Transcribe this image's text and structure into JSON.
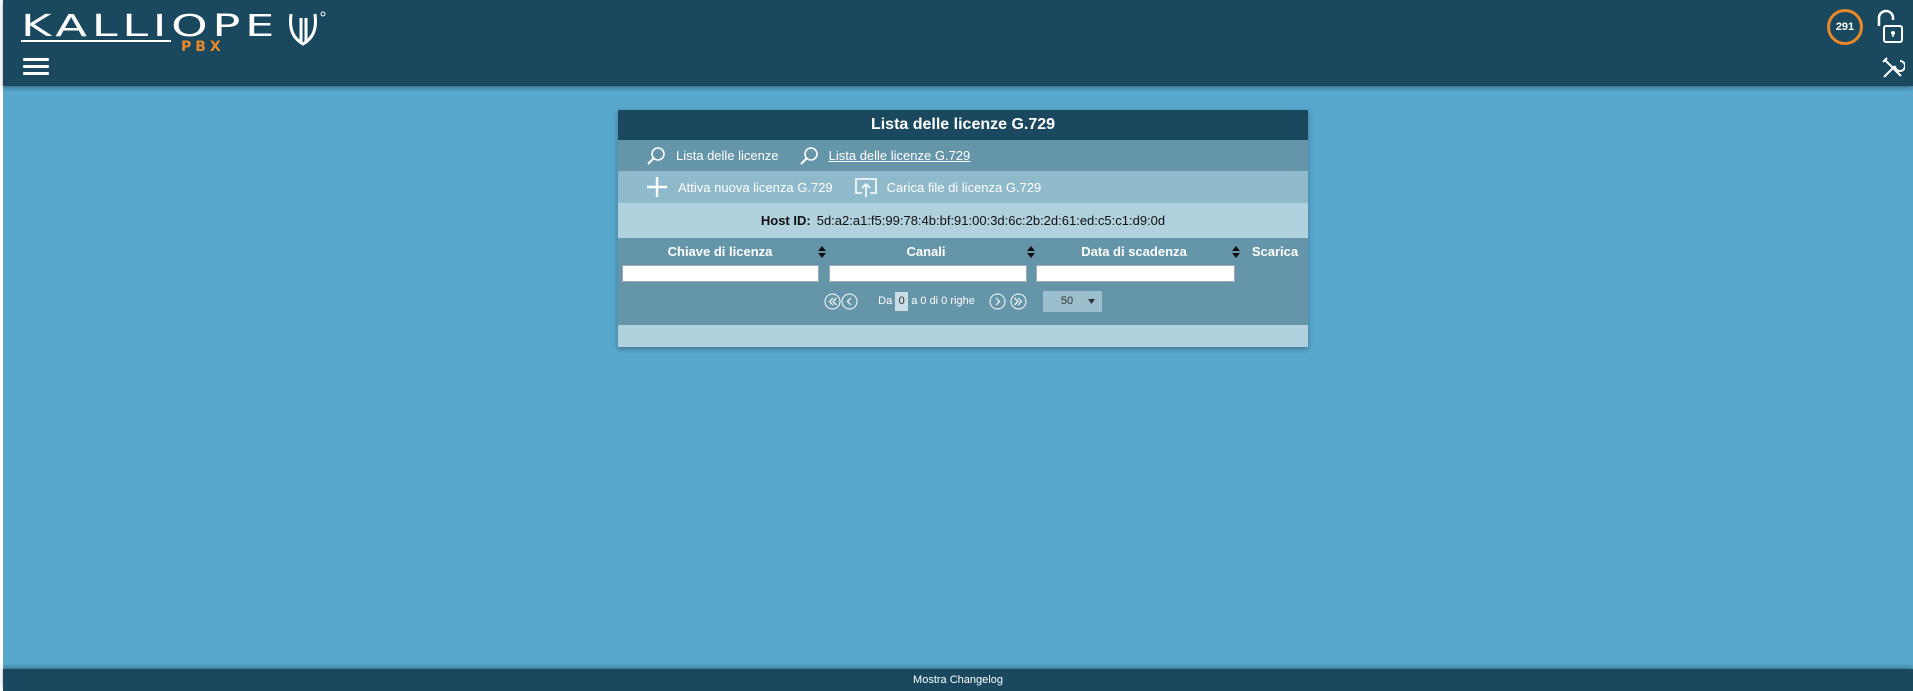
{
  "header": {
    "logo_text": "KALLIOPE",
    "logo_sub": "PBX",
    "notification_count": "291"
  },
  "panel": {
    "title": "Lista delle licenze G.729",
    "nav": [
      {
        "label": "Lista delle licenze",
        "active": false
      },
      {
        "label": "Lista delle licenze G.729",
        "active": true
      }
    ],
    "actions": [
      {
        "label": "Attiva nuova licenza G.729",
        "icon": "plus-icon"
      },
      {
        "label": "Carica file di licenza G.729",
        "icon": "upload-icon"
      }
    ],
    "host": {
      "label": "Host ID:",
      "value": "5d:a2:a1:f5:99:78:4b:bf:91:00:3d:6c:2b:2d:61:ed:c5:c1:d9:0d"
    },
    "table": {
      "columns": [
        "Chiave di licenza",
        "Canali",
        "Data di scadenza",
        "Scarica"
      ],
      "rows": []
    },
    "pager": {
      "prefix": "Da",
      "from_value": "0",
      "suffix": "a 0 di 0 righe",
      "page_size": "50"
    }
  },
  "footer": {
    "changelog_label": "Mostra Changelog"
  },
  "colors": {
    "header_bg": "#19485f",
    "page_bg": "#58a7cc",
    "accent_orange": "#e8892a"
  }
}
